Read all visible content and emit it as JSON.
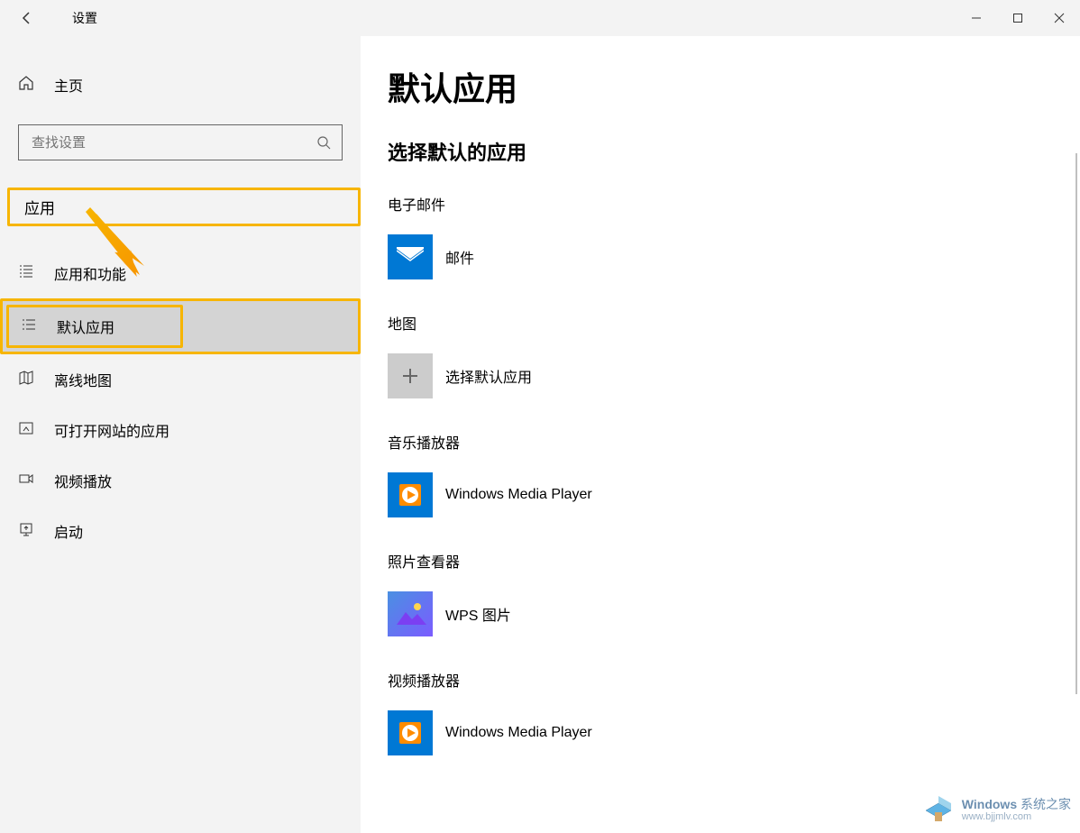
{
  "titlebar": {
    "title": "设置"
  },
  "sidebar": {
    "home": "主页",
    "search_placeholder": "查找设置",
    "category": "应用",
    "items": [
      {
        "label": "应用和功能"
      },
      {
        "label": "默认应用"
      },
      {
        "label": "离线地图"
      },
      {
        "label": "可打开网站的应用"
      },
      {
        "label": "视频播放"
      },
      {
        "label": "启动"
      }
    ]
  },
  "main": {
    "page_title": "默认应用",
    "section_header": "选择默认的应用",
    "categories": [
      {
        "title": "电子邮件",
        "app": "邮件",
        "icon": "mail"
      },
      {
        "title": "地图",
        "app": "选择默认应用",
        "icon": "plus"
      },
      {
        "title": "音乐播放器",
        "app": "Windows Media Player",
        "icon": "wmp"
      },
      {
        "title": "照片查看器",
        "app": "WPS 图片",
        "icon": "wps"
      },
      {
        "title": "视频播放器",
        "app": "Windows Media Player",
        "icon": "wmp"
      }
    ]
  },
  "watermark": {
    "brand": "Windows",
    "suffix": "系统之家",
    "url": "www.bjjmlv.com"
  }
}
